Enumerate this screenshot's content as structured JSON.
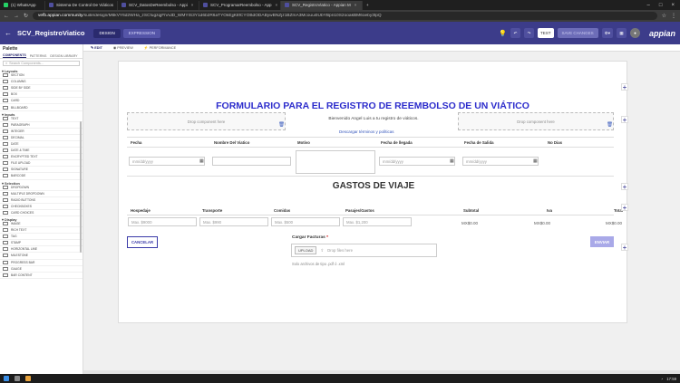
{
  "browser": {
    "tabs": [
      {
        "label": "(1) WhatsApp",
        "color": "#25d366"
      },
      {
        "label": "Sistema De Control De Viáticos",
        "color": "#4f4f9e"
      },
      {
        "label": "SCV_DatosDeReembolso - Appi",
        "color": "#4f4f9e"
      },
      {
        "label": "SCV_ProgramarReembolso - App",
        "color": "#4f4f9e"
      },
      {
        "label": "SCV_RegistroViatico - Appian M",
        "color": "#4f4f9e"
      }
    ],
    "url_host": "vefb.appian.community",
    "url_path": "/suite/design/M6kVY6d2WHa_zSCfugzqjFhAdD_WMYIS3Y1d6b2R6aTYOkEjjK8fCYOBdODABywBNZjz1BZmA3Mcouu4lUbYBpn10S2ooakBM6oeby3tpQ"
  },
  "header": {
    "title": "SCV_RegistroViatico",
    "mode_design": "DESIGN",
    "mode_expression": "EXPRESSION",
    "test_label": "TEST",
    "save_label": "SAVE CHANGES",
    "logo": "appian",
    "brand_color": "#3c3c8a"
  },
  "palette": {
    "title": "Palette",
    "tabs": [
      "COMPONENTS",
      "PATTERNS",
      "DESIGN LIBRARY"
    ],
    "search_placeholder": "Search Components...",
    "sections": [
      {
        "title": "Layouts",
        "items": [
          "SECTION",
          "COLUMNS",
          "SIDE BY SIDE",
          "BOX",
          "CARD",
          "BILLBOARD"
        ]
      },
      {
        "title": "Inputs",
        "items": [
          "TEXT",
          "PARAGRAPH",
          "INTEGER",
          "DECIMAL",
          "DATE",
          "DATE & TIME",
          "ENCRYPTED TEXT",
          "FILE UPLOAD",
          "SIGNATURE",
          "BARCODE"
        ]
      },
      {
        "title": "Selection",
        "items": [
          "DROPDOWN",
          "MULTIPLE DROPDOWN",
          "RADIO BUTTONS",
          "CHECKBOXES",
          "CARD CHOICES"
        ]
      },
      {
        "title": "Display",
        "items": [
          "IMAGE",
          "RICH TEXT",
          "TAG",
          "STAMP",
          "HORIZONTAL LINE",
          "MILESTONE",
          "PROGRESS BAR",
          "GAUGE",
          "BAR CONTENT"
        ]
      }
    ]
  },
  "subtabs": [
    "EDIT",
    "PREVIEW",
    "PERFORMANCE"
  ],
  "form": {
    "title": "FORMULARIO PARA EL REGISTRO DE REEMBOLSO DE UN VIÁTICO",
    "welcome": "Bienvenido Angel Luis a tu registro de viáticos.",
    "drop_here": "Drop component here",
    "link": "Descargar términos y políticas",
    "columns": [
      "Fecha",
      "Nombre Del Viatico",
      "Motivo",
      "Fecha de llegada",
      "Fecha de Salida",
      "No Dias"
    ],
    "date_placeholder": "mm/dd/yyyy",
    "section_title": "GASTOS DE VIAJE",
    "expense_columns": [
      "Hospedaje",
      "Transporte",
      "Comidas",
      "Pasajes/Gastos",
      "Subtotal",
      "Iva",
      "Total"
    ],
    "expense_placeholders": [
      "Max. $9000",
      "Max. $990",
      "Max. $500",
      "Max. $1,200"
    ],
    "subtotal": "MX$0.00",
    "iva": "MX$0.00",
    "total": "MX$0.00",
    "cancel": "CANCELAR",
    "send": "ENVIAR",
    "upload_label": "Cargar Facturas",
    "upload_required": "*",
    "upload_button": "UPLOAD",
    "upload_drop": "Drop files here",
    "upload_hint": "Solo archivos de tipo .pdf ó .xml"
  },
  "taskbar": {
    "clock": "17:59"
  }
}
